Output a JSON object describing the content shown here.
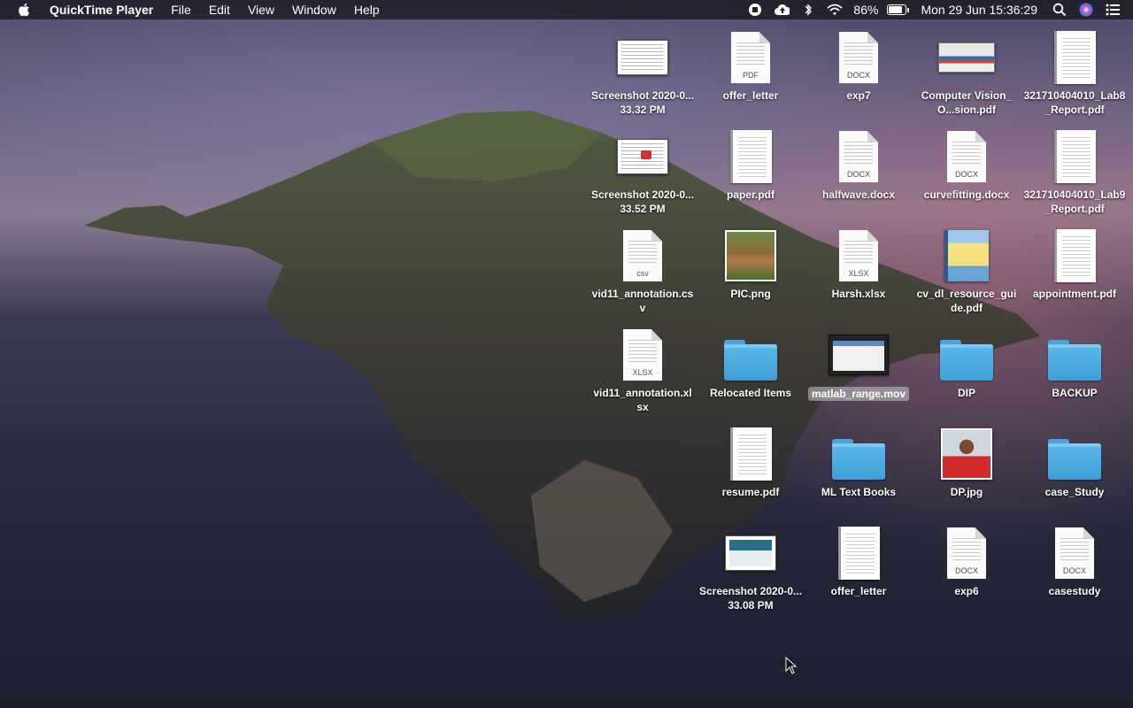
{
  "menubar": {
    "app_name": "QuickTime Player",
    "menus": [
      "File",
      "Edit",
      "View",
      "Window",
      "Help"
    ],
    "battery_percent": "86%",
    "battery_level": 0.86,
    "clock": "Mon 29 Jun  15:36:29",
    "status_icons": [
      "record-stop-icon",
      "cloud-upload-icon",
      "bluetooth-icon",
      "wifi-icon",
      "battery-icon",
      "search-icon",
      "siri-icon",
      "control-center-icon"
    ]
  },
  "desktop": {
    "icons": [
      {
        "label": "Screenshot 2020-0...33.32 PM",
        "kind": "screenshot"
      },
      {
        "label": "offer_letter",
        "kind": "doc",
        "ext": "PDF"
      },
      {
        "label": "exp7",
        "kind": "doc",
        "ext": "DOCX"
      },
      {
        "label": "Computer Vision_O...sion.pdf",
        "kind": "screenshot-wide"
      },
      {
        "label": "321710404010_Lab8_Report.pdf",
        "kind": "pdf"
      },
      {
        "label": "Screenshot 2020-0...33.52 PM",
        "kind": "screenshot-red"
      },
      {
        "label": "paper.pdf",
        "kind": "pdf"
      },
      {
        "label": "halfwave.docx",
        "kind": "doc",
        "ext": "DOCX"
      },
      {
        "label": "curvefitting.docx",
        "kind": "doc",
        "ext": "DOCX"
      },
      {
        "label": "321710404010_Lab9_Report.pdf",
        "kind": "pdf"
      },
      {
        "label": "vid11_annotation.csv",
        "kind": "doc",
        "ext": "csv"
      },
      {
        "label": "PIC.png",
        "kind": "photo-pic"
      },
      {
        "label": "Harsh.xlsx",
        "kind": "doc",
        "ext": "XLSX"
      },
      {
        "label": "cv_dl_resource_guide.pdf",
        "kind": "book"
      },
      {
        "label": "appointment.pdf",
        "kind": "pdf"
      },
      {
        "label": "vid11_annotation.xlsx",
        "kind": "doc",
        "ext": "XLSX"
      },
      {
        "label": "Relocated Items",
        "kind": "folder"
      },
      {
        "label": "matlab_range.mov",
        "kind": "movie",
        "selected": true
      },
      {
        "label": "DIP",
        "kind": "folder"
      },
      {
        "label": "BACKUP",
        "kind": "folder"
      },
      {
        "label": "resume.pdf",
        "kind": "pdf"
      },
      {
        "label": "ML Text Books",
        "kind": "folder"
      },
      {
        "label": "DP.jpg",
        "kind": "photo-dp"
      },
      {
        "label": "case_Study",
        "kind": "folder"
      },
      {
        "label": "Screenshot 2020-0...33.08 PM",
        "kind": "screenshot-teal"
      },
      {
        "label": "offer_letter",
        "kind": "pdf"
      },
      {
        "label": "exp6",
        "kind": "doc",
        "ext": "DOCX"
      },
      {
        "label": "casestudy",
        "kind": "doc",
        "ext": "DOCX"
      }
    ]
  }
}
